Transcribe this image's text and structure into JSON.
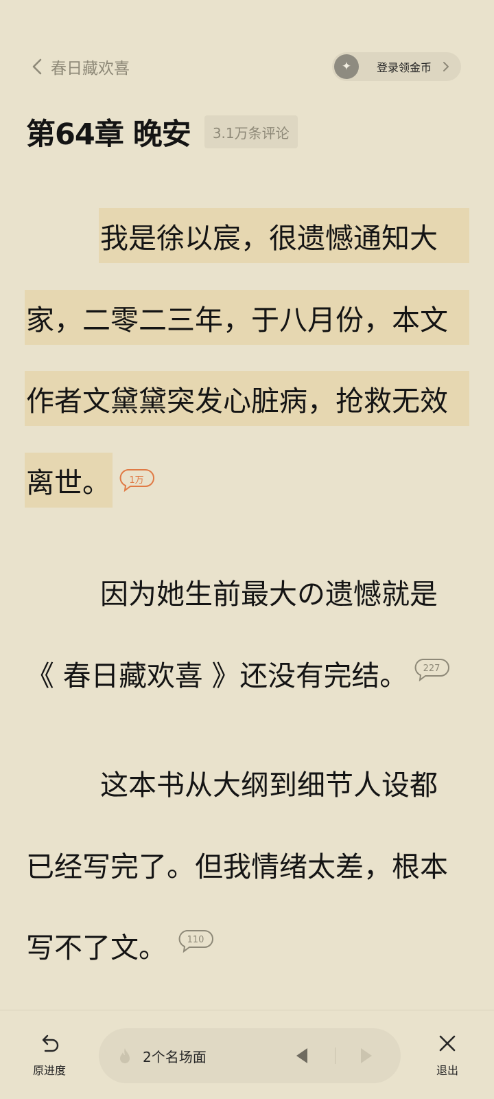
{
  "header": {
    "book_title": "春日藏欢喜",
    "login_label": "登录领金币"
  },
  "chapter": {
    "title": "第64章 晚安",
    "comment_count": "3.1万条评论"
  },
  "paragraphs": [
    {
      "lines": [
        "我是徐以宸，很遗憾通知大",
        "家，二零二三年，于八月份，本文",
        "作者文黛黛突发心脏病，抢救无效",
        "离世。"
      ],
      "highlighted": true,
      "comment_badge": "1万"
    },
    {
      "lines": [
        "因为她生前最大の遗憾就是",
        "《 春日藏欢喜 》还没有完结。"
      ],
      "highlighted": false,
      "comment_badge": "227"
    },
    {
      "lines": [
        "这本书从大纲到细节人设都",
        "已经写完了。但我情绪太差，根本",
        "写不了文。"
      ],
      "highlighted": false,
      "comment_badge": "110"
    }
  ],
  "bottom_bar": {
    "progress_label": "原进度",
    "scene_label": "2个名场面",
    "exit_label": "退出"
  },
  "icons": {
    "back": "chevron-left-icon",
    "coin": "sparkle-coin-icon",
    "login_arrow": "chevron-right-icon",
    "progress": "undo-arrow-icon",
    "flame": "flame-icon",
    "prev": "triangle-left-icon",
    "next": "triangle-right-icon",
    "exit": "close-icon"
  },
  "colors": {
    "background": "#e9e2cc",
    "highlight": "#e6d7b1",
    "hot_badge": "#e07a45",
    "muted_text": "#8e8978"
  }
}
